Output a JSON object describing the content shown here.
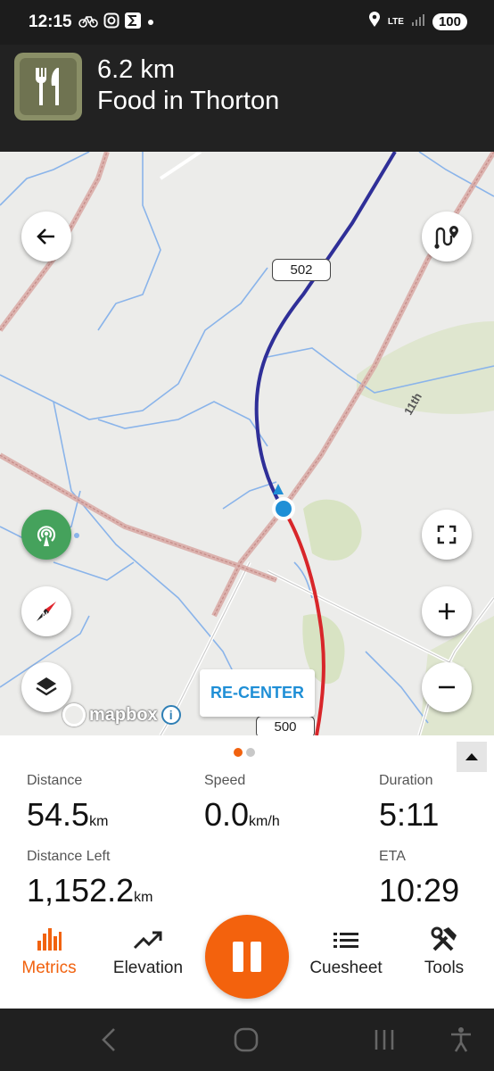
{
  "status_bar": {
    "time": "12:15",
    "battery": "100",
    "network": "LTE",
    "icons": [
      "bike-icon",
      "instagram-icon",
      "sigma-icon",
      "dot-icon",
      "location-icon",
      "lte-icon",
      "signal-icon",
      "battery-icon"
    ]
  },
  "nav_header": {
    "distance": "6.2 km",
    "destination": "Food in Thorton",
    "icon": "fork-knife-icon",
    "icon_color": "#8a8f67"
  },
  "map": {
    "road_labels": [
      "502",
      "500"
    ],
    "road_name": "11th",
    "recenter_label": "RE-CENTER",
    "attribution": "mapbox",
    "route_ahead_color": "#2f2f98",
    "route_done_color": "#d8262a",
    "position_color": "#1f8fd6"
  },
  "metrics": {
    "distance": {
      "label": "Distance",
      "value": "54.5",
      "unit": "km"
    },
    "speed": {
      "label": "Speed",
      "value": "0.0",
      "unit": "km/h"
    },
    "duration": {
      "label": "Duration",
      "value": "5:11"
    },
    "distance_left": {
      "label": "Distance Left",
      "value": "1,152.2",
      "unit": "km"
    },
    "eta": {
      "label": "ETA",
      "value": "10:29"
    },
    "page_dots": {
      "count": 2,
      "active": 0
    }
  },
  "tabs": [
    {
      "label": "Metrics",
      "icon": "bar-chart-icon",
      "active": true
    },
    {
      "label": "Elevation",
      "icon": "trend-icon",
      "active": false
    },
    {
      "label": "Cuesheet",
      "icon": "list-icon",
      "active": false
    },
    {
      "label": "Tools",
      "icon": "tools-icon",
      "active": false
    }
  ],
  "accent_color": "#f1620f"
}
